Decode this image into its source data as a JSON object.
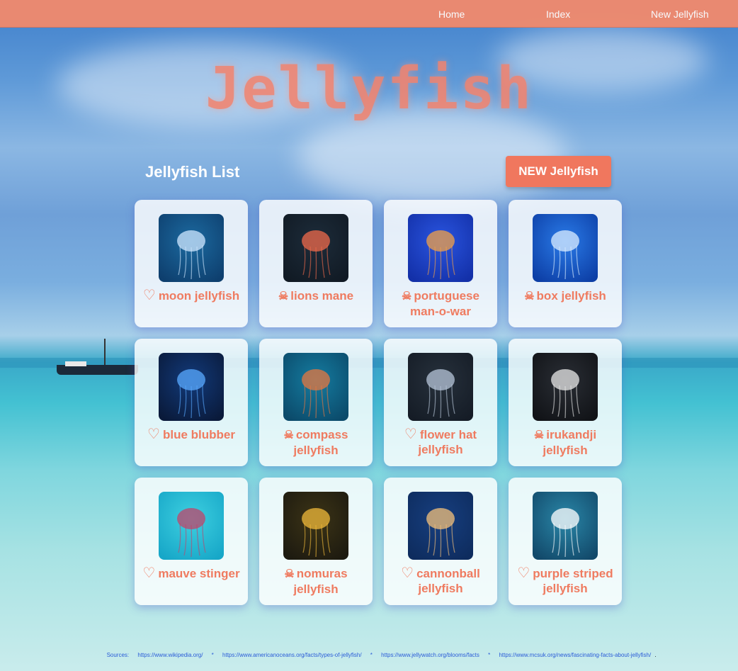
{
  "nav": {
    "home": "Home",
    "index": "Index",
    "new": "New Jellyfish"
  },
  "title": "Jellyfish",
  "list_heading": "Jellyfish List",
  "new_button": "NEW Jellyfish",
  "cards": [
    {
      "symbol": "♡",
      "name": "moon jellyfish",
      "kind": "heart"
    },
    {
      "symbol": "☠",
      "name": "lions mane",
      "kind": "skull"
    },
    {
      "symbol": "☠",
      "name": "portuguese man-o-war",
      "kind": "skull"
    },
    {
      "symbol": "☠",
      "name": "box jellyfish",
      "kind": "skull"
    },
    {
      "symbol": "♡",
      "name": "blue blubber",
      "kind": "heart"
    },
    {
      "symbol": "☠",
      "name": "compass jellyfish",
      "kind": "skull"
    },
    {
      "symbol": "♡",
      "name": "flower hat jellyfish",
      "kind": "heart"
    },
    {
      "symbol": "☠",
      "name": "irukandji jellyfish",
      "kind": "skull"
    },
    {
      "symbol": "♡",
      "name": "mauve stinger",
      "kind": "heart"
    },
    {
      "symbol": "☠",
      "name": "nomuras jellyfish",
      "kind": "skull"
    },
    {
      "symbol": "♡",
      "name": "cannonball jellyfish",
      "kind": "heart"
    },
    {
      "symbol": "♡",
      "name": "purple striped jellyfish",
      "kind": "heart"
    }
  ],
  "footer": {
    "label": "Sources:",
    "links": [
      "https://www.wikipedia.org/",
      "https://www.americanoceans.org/facts/types-of-jellyfish/",
      "https://www.jellywatch.org/blooms/facts",
      "https://www.mcsuk.org/news/fascinating-facts-about-jellyfish/"
    ],
    "separator": "*",
    "end": "."
  },
  "colors": {
    "accent": "#f0775e",
    "navbar": "#f08a6e",
    "card_text": "#ef7b60",
    "link": "#2a5bd7"
  }
}
